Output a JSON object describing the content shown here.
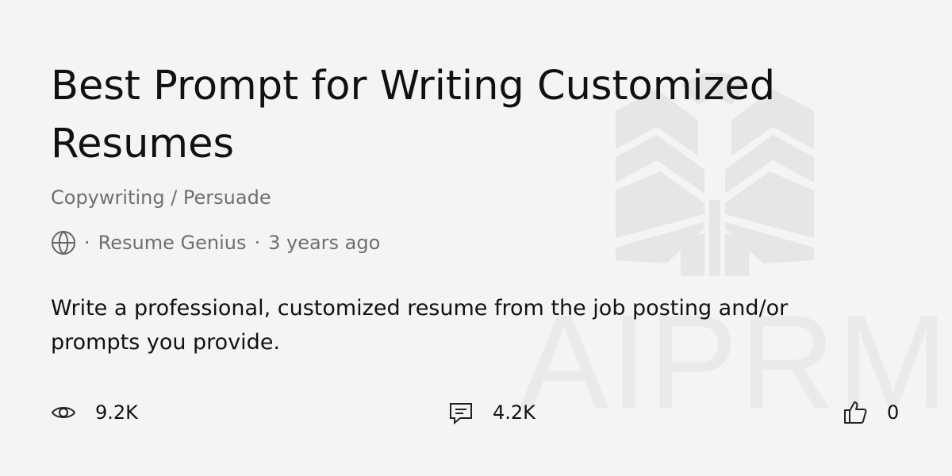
{
  "card": {
    "title": "Best Prompt for Writing Customized Resumes",
    "category": "Copywriting / Persuade",
    "meta": {
      "visibility_icon": "globe-icon",
      "separator": "·",
      "author": "Resume Genius",
      "time_ago": "3 years ago"
    },
    "description": "Write a professional, customized resume from the job posting and/or prompts you provide.",
    "stats": {
      "views": {
        "icon": "eye-icon",
        "value": "9.2K"
      },
      "comments": {
        "icon": "comment-icon",
        "value": "4.2K"
      },
      "likes": {
        "icon": "thumbs-up-icon",
        "value": "0"
      }
    },
    "watermark": {
      "text": "AIPRM",
      "color": "#eaeaea",
      "logo_icon": "aiprm-logo-icon"
    }
  }
}
